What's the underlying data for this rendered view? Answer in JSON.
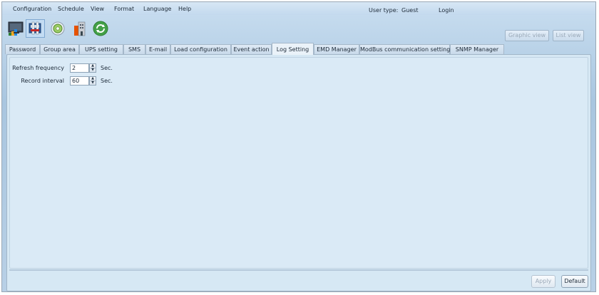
{
  "menu": {
    "items": [
      "Configuration",
      "Schedule",
      "View",
      "Format",
      "Language",
      "Help"
    ]
  },
  "user": {
    "type_label": "User type:",
    "type_value": "Guest",
    "login_label": "Login"
  },
  "toolbar": {
    "icons": [
      "monitor-chart-icon",
      "settings-tools-icon",
      "disc-icon",
      "building-icon",
      "refresh-icon"
    ],
    "graphic_view_label": "Graphic view",
    "list_view_label": "List view"
  },
  "tabs": [
    "Password",
    "Group area",
    "UPS setting",
    "SMS",
    "E-mail",
    "Load configuration",
    "Event action",
    "Log Setting",
    "EMD Manager",
    "ModBus communication setting",
    "SNMP Manager"
  ],
  "active_tab": "Log Setting",
  "form": {
    "refresh": {
      "label": "Refresh frequency",
      "value": "2",
      "unit": "Sec."
    },
    "record": {
      "label": "Record interval",
      "value": "60",
      "unit": "Sec."
    }
  },
  "footer": {
    "apply_label": "Apply",
    "default_label": "Default"
  },
  "colors": {
    "background": "#b9d2e8",
    "panel": "#daeaf6",
    "active_tab": "#eaf2f9"
  }
}
